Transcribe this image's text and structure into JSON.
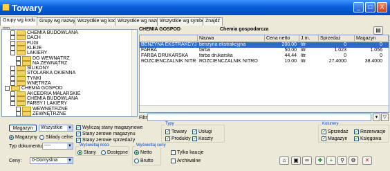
{
  "window": {
    "title": "Towary",
    "min": "_",
    "max": "□",
    "close": "X"
  },
  "tabs": [
    "Grupy wg kodu",
    "Grupy wg nazwy",
    "Wszystkie wg kodu",
    "Wszystkie wg nazwy",
    "Wszystkie wg symbolu",
    "Znajdź"
  ],
  "tree": [
    {
      "label": "CHEMIA BUDOWLANA",
      "indent": 1
    },
    {
      "label": "DACH",
      "indent": 1
    },
    {
      "label": "FUGI",
      "indent": 1
    },
    {
      "label": "KLEJE",
      "indent": 1
    },
    {
      "label": "LAKIERY",
      "indent": 1
    },
    {
      "label": "DO WEWNĄTRZ",
      "indent": 2
    },
    {
      "label": "NA ZEWNĄTRZ",
      "indent": 2
    },
    {
      "label": "SILIKONY",
      "indent": 1
    },
    {
      "label": "STOLARKA OKIENNA",
      "indent": 1
    },
    {
      "label": "TYNKI",
      "indent": 1
    },
    {
      "label": "WNĘTRZA",
      "indent": 1
    },
    {
      "label": "CHEMIA GOSPOD",
      "indent": 0
    },
    {
      "label": "AKCEDRIA MALARSKIE",
      "indent": 1
    },
    {
      "label": "CHEMIA BUDOWLANA",
      "indent": 1
    },
    {
      "label": "FARBY I LAKIERY",
      "indent": 1
    },
    {
      "label": "WEWNĘTRZNE",
      "indent": 2
    },
    {
      "label": "ZEWNĘTRZNE",
      "indent": 2
    }
  ],
  "group_code": "CHEMIA GOSPOD",
  "group_name": "Chemia gospodarcza",
  "grid": {
    "headers": [
      "Nazwa",
      "Cena netto",
      "J.m.",
      "Sprzedaż",
      "Magazyn"
    ],
    "rows": [
      {
        "code": "BENZYNA EKSTRAKCYJNA",
        "name": "benzyna ekstrakcyjna",
        "price": "200.00",
        "unit": "litr",
        "sale": "0",
        "stock": "0"
      },
      {
        "code": "FARBA",
        "name": "farba",
        "price": "50.00",
        "unit": "litr",
        "sale": "1.023",
        "stock": "1.056"
      },
      {
        "code": "FARBA DRUKARSKA",
        "name": "farba drukarska",
        "price": "44.44",
        "unit": "litr",
        "sale": "0",
        "stock": "0"
      },
      {
        "code": "ROZCIEŃCZALNIK NITRO",
        "name": "ROZCIEŃCZALNIK NITRO",
        "price": "10.00",
        "unit": "litr",
        "sale": "27.4000",
        "stock": "38.4000"
      }
    ]
  },
  "filter_label": "Filtr",
  "bottom": {
    "magazyn_btn": "Magazyn",
    "magazyn_val": "Wszystkie",
    "radio_magazyny": "Magazyny",
    "radio_sklady": "Składy celne",
    "typ_dok_label": "Typ dokumentu:",
    "typ_dok_val": "----",
    "cb_wyliczaj": "Wyliczaj stany magazynowe",
    "cb_zerowe_mag": "Stany zerowe magazynu",
    "cb_zerowe_sprz": "Stany zerowe sprzedaży",
    "wyswietlaj_ilosci": "Wyświetlaj ilości",
    "radio_stany": "Stany",
    "radio_dostepne": "Dostępne",
    "wyswietlaj_ceny": "Wyświetlaj ceny",
    "radio_netto": "Netto",
    "radio_brutto": "Brutto",
    "cb_tylko_kaucje": "Tylko kaucje",
    "cb_archiwalne": "Archiwalne",
    "ceny_label": "Ceny:",
    "ceny_val": "0-Domyślna",
    "typy_title": "Typy",
    "cb_towary": "Towary",
    "cb_uslugi": "Usługi",
    "cb_produkty": "Produkty",
    "cb_koszty": "Koszty",
    "kolumny_title": "Kolumny",
    "cb_sprzedaz": "Sprzedaż",
    "cb_rezerwacje": "Rezerwacje",
    "cb_magazyn": "Magazyn",
    "cb_ksiegowa": "Księgowa"
  }
}
